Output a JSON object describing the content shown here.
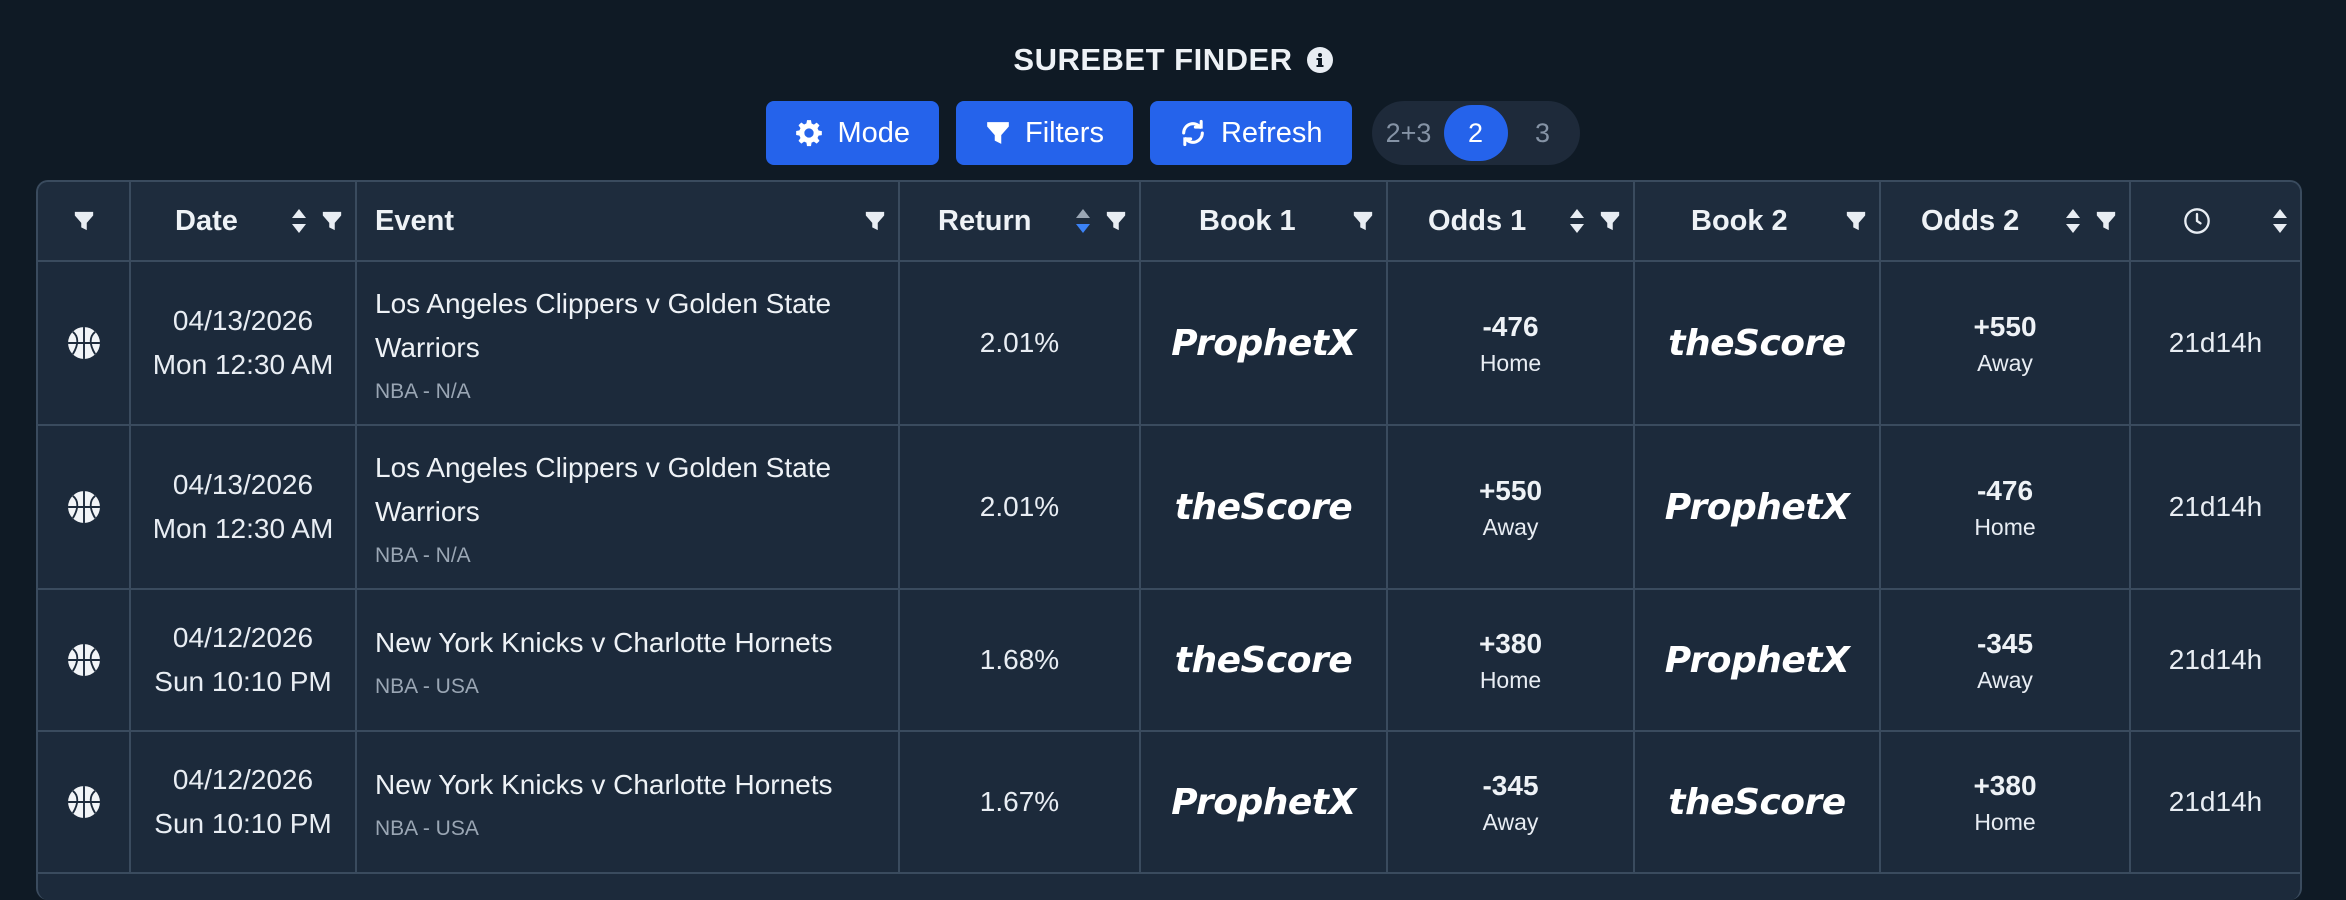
{
  "header": {
    "title": "SUREBET FINDER"
  },
  "toolbar": {
    "mode_label": "Mode",
    "filters_label": "Filters",
    "refresh_label": "Refresh",
    "legs": {
      "options": [
        "2+3",
        "2",
        "3"
      ],
      "selected": "2"
    }
  },
  "table": {
    "columns": {
      "date": "Date",
      "event": "Event",
      "return": "Return",
      "book1": "Book 1",
      "odds1": "Odds 1",
      "book2": "Book 2",
      "odds2": "Odds 2"
    },
    "sort_active_column": "Return",
    "rows": [
      {
        "sport_icon": "basketball-icon",
        "date": "04/13/2026",
        "time": "Mon 12:30 AM",
        "event": "Los Angeles Clippers v Golden State Warriors",
        "league": "NBA - N/A",
        "return": "2.01%",
        "book1": "ProphetX",
        "odds1": "-476",
        "side1": "Home",
        "book2": "theScore",
        "odds2": "+550",
        "side2": "Away",
        "time_left": "21d14h"
      },
      {
        "sport_icon": "basketball-icon",
        "date": "04/13/2026",
        "time": "Mon 12:30 AM",
        "event": "Los Angeles Clippers v Golden State Warriors",
        "league": "NBA - N/A",
        "return": "2.01%",
        "book1": "theScore",
        "odds1": "+550",
        "side1": "Away",
        "book2": "ProphetX",
        "odds2": "-476",
        "side2": "Home",
        "time_left": "21d14h"
      },
      {
        "sport_icon": "basketball-icon",
        "date": "04/12/2026",
        "time": "Sun 10:10 PM",
        "event": "New York Knicks v Charlotte Hornets",
        "league": "NBA - USA",
        "return": "1.68%",
        "book1": "theScore",
        "odds1": "+380",
        "side1": "Home",
        "book2": "ProphetX",
        "odds2": "-345",
        "side2": "Away",
        "time_left": "21d14h"
      },
      {
        "sport_icon": "basketball-icon",
        "date": "04/12/2026",
        "time": "Sun 10:10 PM",
        "event": "New York Knicks v Charlotte Hornets",
        "league": "NBA - USA",
        "return": "1.67%",
        "book1": "ProphetX",
        "odds1": "-345",
        "side1": "Away",
        "book2": "theScore",
        "odds2": "+380",
        "side2": "Home",
        "time_left": "21d14h"
      }
    ]
  },
  "colors": {
    "background": "#0f1a25",
    "accent": "#2563eb",
    "table_bg": "#1c2a3b",
    "border": "#3a4b5e"
  }
}
